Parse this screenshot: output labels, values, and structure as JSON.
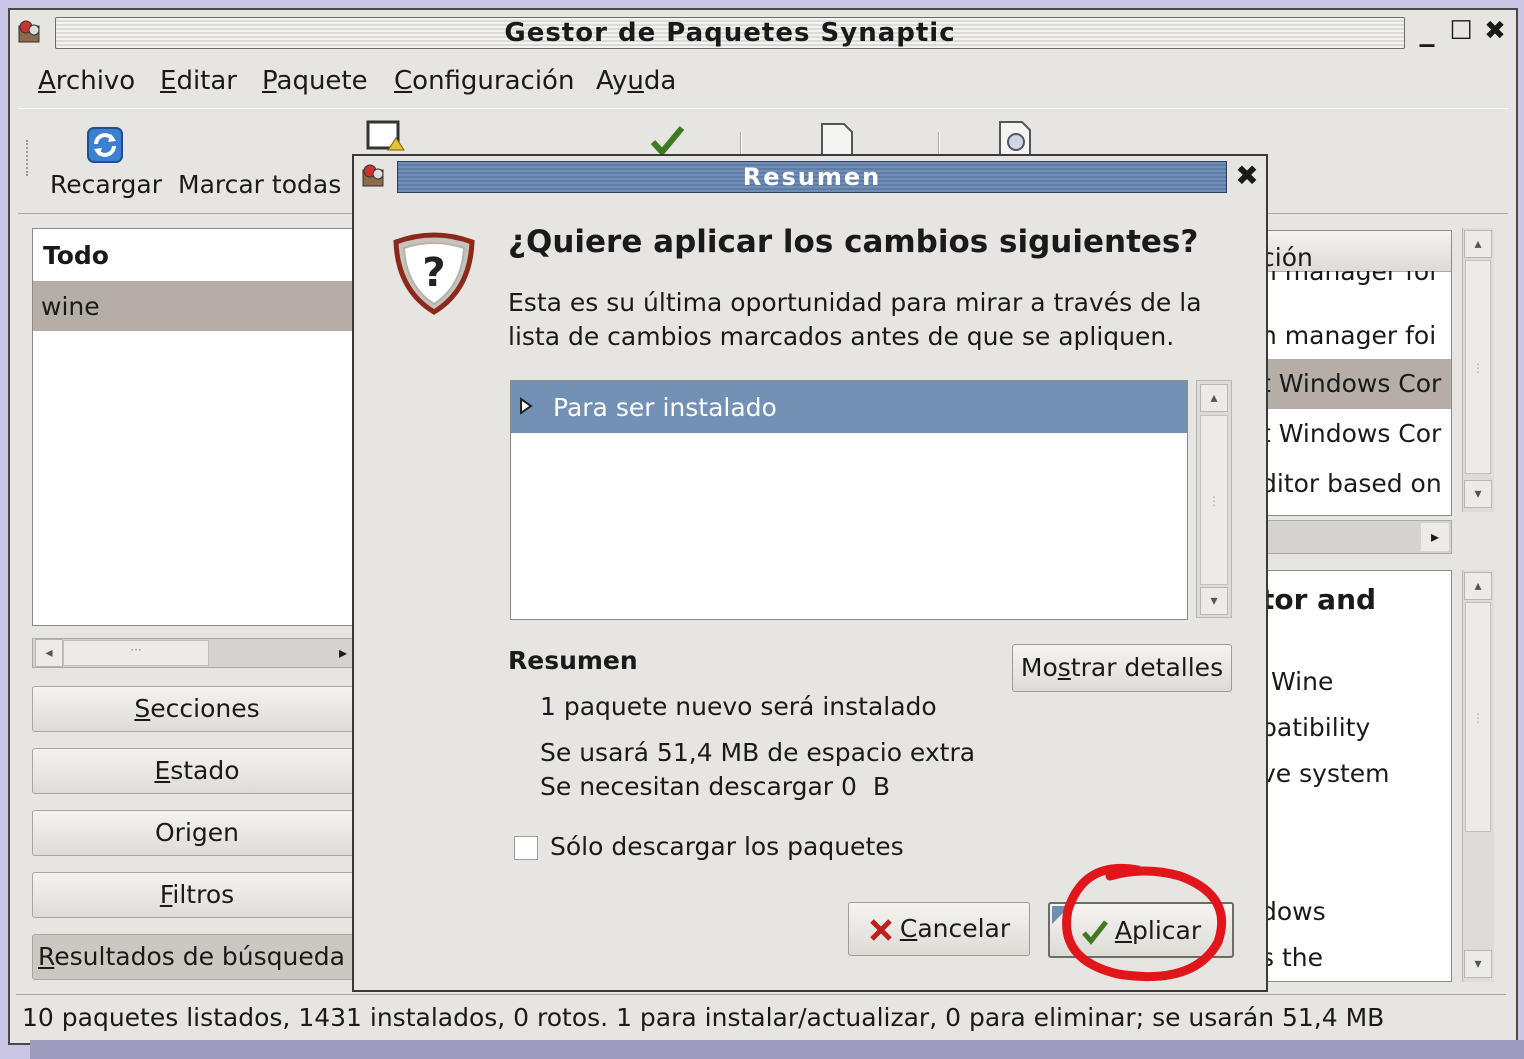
{
  "window": {
    "title": "Gestor de Paquetes Synaptic",
    "controls": {
      "minimize": "_",
      "maximize": "☐",
      "close": "✖"
    }
  },
  "menubar": {
    "items": [
      {
        "pre": "",
        "key": "A",
        "post": "rchivo"
      },
      {
        "pre": "",
        "key": "E",
        "post": "ditar"
      },
      {
        "pre": "",
        "key": "P",
        "post": "aquete"
      },
      {
        "pre": "",
        "key": "C",
        "post": "onfiguración"
      },
      {
        "pre": "Ay",
        "key": "u",
        "post": "da"
      }
    ]
  },
  "toolbar": {
    "reload_label": "Recargar",
    "mark_all_label": "Marcar todas"
  },
  "left_panel": {
    "header": "Todo",
    "selected_item": "wine",
    "buttons": {
      "sections": {
        "pre": "",
        "key": "S",
        "post": "ecciones"
      },
      "status": {
        "pre": "",
        "key": "E",
        "post": "stado"
      },
      "origin": "Origen",
      "filters": {
        "pre": "",
        "key": "F",
        "post": "iltros"
      },
      "search_results": {
        "pre": "",
        "key": "R",
        "post": "esultados de búsqueda"
      }
    }
  },
  "package_list": {
    "header_fragment": "ción",
    "rows": [
      "n manager foi",
      "n manager foi",
      "t Windows Cor",
      "t Windows Cor",
      "ditor based on"
    ]
  },
  "description_panel": {
    "heading_fragment": "tor and",
    "lines": [
      "Wine",
      "patibility",
      "ve system",
      "",
      "",
      "dows",
      "s the"
    ]
  },
  "statusbar": {
    "text": "10 paquetes listados, 1431 instalados, 0 rotos. 1 para instalar/actualizar, 0 para eliminar; se usarán 51,4 MB"
  },
  "dialog": {
    "title": "Resumen",
    "close": "✖",
    "question": "¿Quiere aplicar los cambios siguientes?",
    "explanation_line1": "Esta es su última oportunidad para mirar a través de la",
    "explanation_line2": "lista de cambios marcados antes de que se apliquen.",
    "tree_item": "Para ser instalado",
    "summary_heading": "Resumen",
    "show_details": {
      "pre": "Mo",
      "key": "s",
      "post": "trar detalles"
    },
    "summary_lines": [
      "1 paquete nuevo será instalado",
      "Se usará 51,4 MB de espacio extra",
      "Se necesitan descargar 0  B"
    ],
    "download_only_label": "Sólo descargar los paquetes",
    "cancel": {
      "pre": "",
      "key": "C",
      "post": "ancelar"
    },
    "apply": {
      "pre": "",
      "key": "A",
      "post": "plicar"
    }
  },
  "colors": {
    "selection": "#b4aea6",
    "dialog_title_bg": "#6f8db5",
    "tree_selection": "#7391b4",
    "highlight_circle": "#e0161b"
  }
}
